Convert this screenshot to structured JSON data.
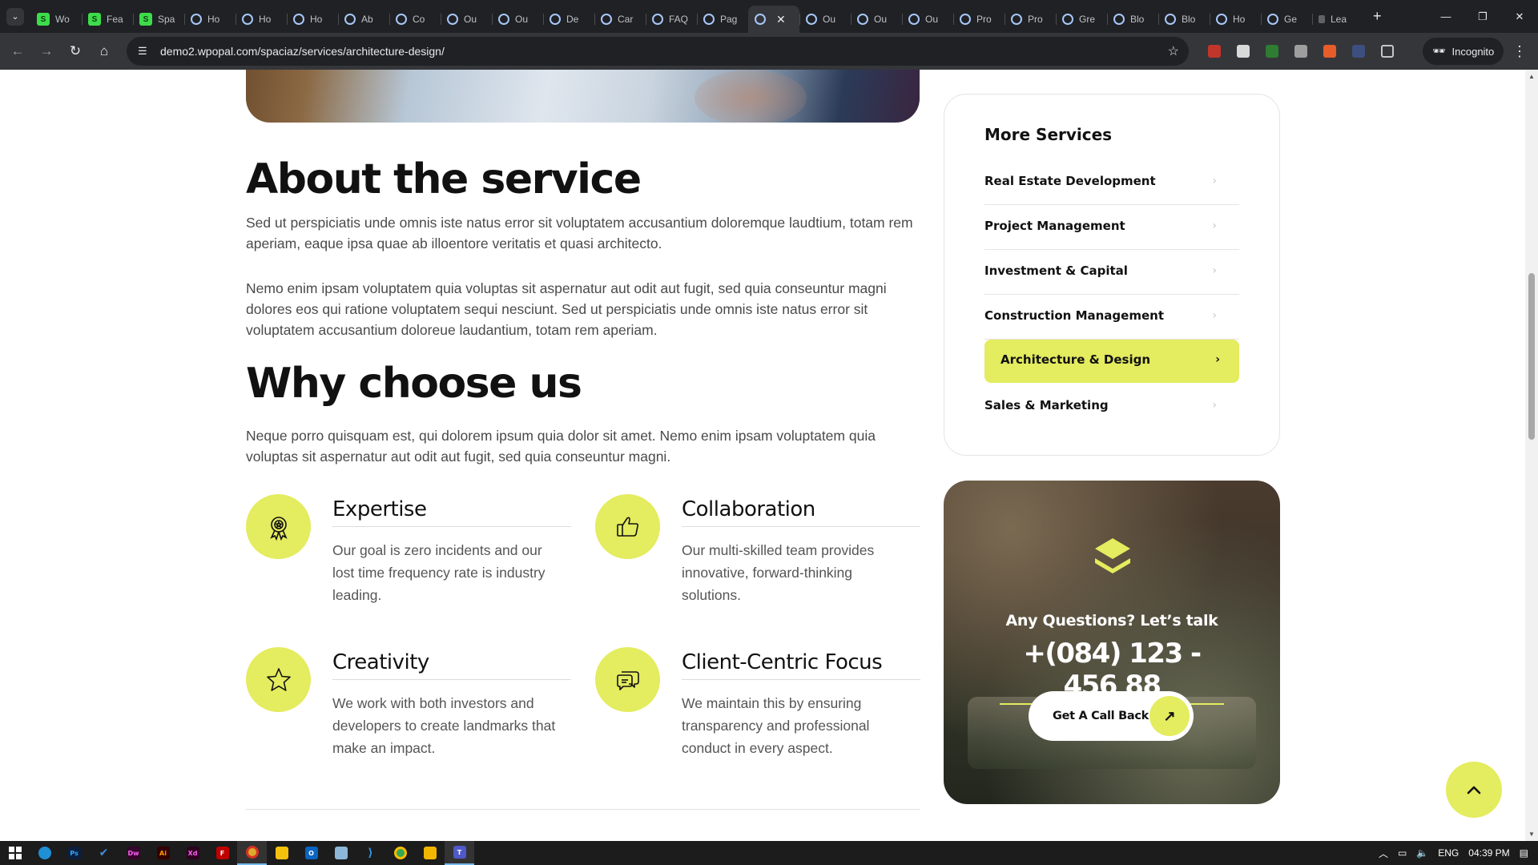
{
  "browser": {
    "tabs": [
      {
        "label": "Wo",
        "icon": "green-favicon"
      },
      {
        "label": "Fea",
        "icon": "green-favicon"
      },
      {
        "label": "Spa",
        "icon": "green-favicon"
      },
      {
        "label": "Ho",
        "icon": "ring-favicon"
      },
      {
        "label": "Ho",
        "icon": "ring-favicon"
      },
      {
        "label": "Ho",
        "icon": "ring-favicon"
      },
      {
        "label": "Ab",
        "icon": "ring-favicon"
      },
      {
        "label": "Co",
        "icon": "ring-favicon"
      },
      {
        "label": "Ou",
        "icon": "ring-favicon"
      },
      {
        "label": "Ou",
        "icon": "ring-favicon"
      },
      {
        "label": "De",
        "icon": "ring-favicon"
      },
      {
        "label": "Car",
        "icon": "ring-favicon"
      },
      {
        "label": "FAQ",
        "icon": "ring-favicon"
      },
      {
        "label": "Pag",
        "icon": "ring-favicon"
      },
      {
        "label": "",
        "icon": "ring-favicon",
        "active": true
      },
      {
        "label": "Ou",
        "icon": "ring-favicon"
      },
      {
        "label": "Ou",
        "icon": "ring-favicon"
      },
      {
        "label": "Ou",
        "icon": "ring-favicon"
      },
      {
        "label": "Pro",
        "icon": "ring-favicon"
      },
      {
        "label": "Pro",
        "icon": "ring-favicon"
      },
      {
        "label": "Gre",
        "icon": "ring-favicon"
      },
      {
        "label": "Blo",
        "icon": "ring-favicon"
      },
      {
        "label": "Blo",
        "icon": "ring-favicon"
      },
      {
        "label": "Ho",
        "icon": "ring-favicon"
      },
      {
        "label": "Ge",
        "icon": "ring-favicon"
      },
      {
        "label": "Lea",
        "icon": "page-favicon"
      }
    ],
    "url": "demo2.wpopal.com/spaciaz/services/architecture-design/",
    "incognito_label": "Incognito"
  },
  "content": {
    "about_title": "About the service",
    "about_p1": "Sed ut perspiciatis unde omnis iste natus error sit voluptatem accusantium doloremque laudtium, totam rem aperiam, eaque ipsa quae ab illoentore veritatis et quasi architecto.",
    "about_p2": "Nemo enim ipsam voluptatem quia voluptas sit aspernatur aut odit aut fugit, sed quia conseuntur magni dolores eos qui ratione voluptatem sequi nesciunt. Sed ut perspiciatis unde omnis iste natus error sit voluptatem accusantium doloreue laudantium, totam rem aperiam.",
    "why_title": "Why choose us",
    "why_p": "Neque porro quisquam est, qui dolorem ipsum quia dolor sit amet. Nemo enim ipsam voluptatem quia voluptas sit aspernatur aut odit aut fugit, sed quia conseuntur magni.",
    "features": [
      {
        "title": "Expertise",
        "text": "Our goal is zero incidents and our lost time frequency rate is industry leading.",
        "icon": "award-icon"
      },
      {
        "title": "Collaboration",
        "text": "Our multi-skilled team provides innovative, forward-thinking solutions.",
        "icon": "thumbs-up-icon"
      },
      {
        "title": "Creativity",
        "text": "We work with both investors and developers to create landmarks that make an impact.",
        "icon": "star-icon"
      },
      {
        "title": "Client-Centric Focus",
        "text": "We maintain this by ensuring transparency and professional conduct in every aspect.",
        "icon": "chat-bubbles-icon"
      }
    ]
  },
  "sidebar": {
    "services_title": "More Services",
    "services": [
      {
        "label": "Real Estate Development"
      },
      {
        "label": "Project Management"
      },
      {
        "label": "Investment & Capital"
      },
      {
        "label": "Construction Management"
      },
      {
        "label": "Architecture & Design",
        "active": true
      },
      {
        "label": "Sales & Marketing"
      }
    ],
    "cta": {
      "question": "Any Questions? Let’s talk",
      "phone": "+(084) 123 - 456 88",
      "button_label": "Get A Call Back"
    }
  },
  "taskbar": {
    "language": "ENG",
    "time": "04:39 PM"
  },
  "colors": {
    "accent": "#e4ec5f",
    "dark_text": "#111111",
    "body_text": "#4a4a4a"
  }
}
